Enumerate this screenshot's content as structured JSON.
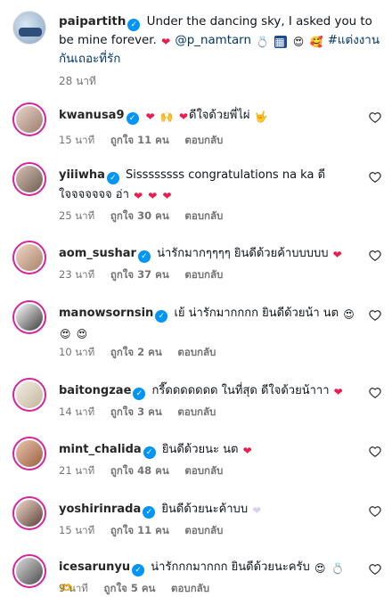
{
  "caption": {
    "username": "paipartith",
    "text_1": "Under the dancing sky, I asked you to be mine forever.",
    "mention": "@p_namtarn",
    "hashtag": "#แต่งงานกันเถอะที่รัก",
    "time": "28 นาที",
    "emojis": [
      "red-heart",
      "ring",
      "diamond-pattern",
      "heart-eyes-face",
      "smiling-face-with-hearts"
    ]
  },
  "comments": [
    {
      "username": "kwanusa9",
      "text": "ดีใจด้วยพี่ไผ่",
      "time": "15 นาที",
      "likes": "ถูกใจ 11 คน",
      "reply": "ตอบกลับ"
    },
    {
      "username": "yiiiwha",
      "text": "Sissssssss congratulations na ka ดีใจจจจจจจ อ่า",
      "time": "25 นาที",
      "likes": "ถูกใจ 30 คน",
      "reply": "ตอบกลับ"
    },
    {
      "username": "aom_sushar",
      "text": "น่ารักมากๆๆๆๆ ยินดีด้วยค้าบบบบบ",
      "time": "23 นาที",
      "likes": "ถูกใจ 37 คน",
      "reply": "ตอบกลับ"
    },
    {
      "username": "manowsornsin",
      "text": "เย้ น่ารักมากกกก ยินดีด้วยน้า นต",
      "time": "10 นาที",
      "likes": "ถูกใจ 2 คน",
      "reply": "ตอบกลับ"
    },
    {
      "username": "baitongzae",
      "text": "กรี๊ดดดดดดด ในที่สุด ดีใจด้วยน้าาา",
      "time": "14 นาที",
      "likes": "ถูกใจ 3 คน",
      "reply": "ตอบกลับ"
    },
    {
      "username": "mint_chalida",
      "text": "ยินดีด้วยนะ นต",
      "time": "21 นาที",
      "likes": "ถูกใจ 48 คน",
      "reply": "ตอบกลับ"
    },
    {
      "username": "yoshirinrada",
      "text": "ยินดีด้วยนะค้าบบ",
      "time": "15 นาที",
      "likes": "ถูกใจ 11 คน",
      "reply": "ตอบกลับ"
    },
    {
      "username": "icesarunyu",
      "text": "น่ารักกกมากกก ยินดีด้วยนะครับ",
      "time": "9 นาที",
      "likes": "ถูกใจ 5 คน",
      "reply": "ตอบกลับ"
    }
  ],
  "colors": {
    "accent": "#0095f6",
    "link": "#00376b",
    "heart": "#ed1b4f",
    "muted": "#737373"
  }
}
